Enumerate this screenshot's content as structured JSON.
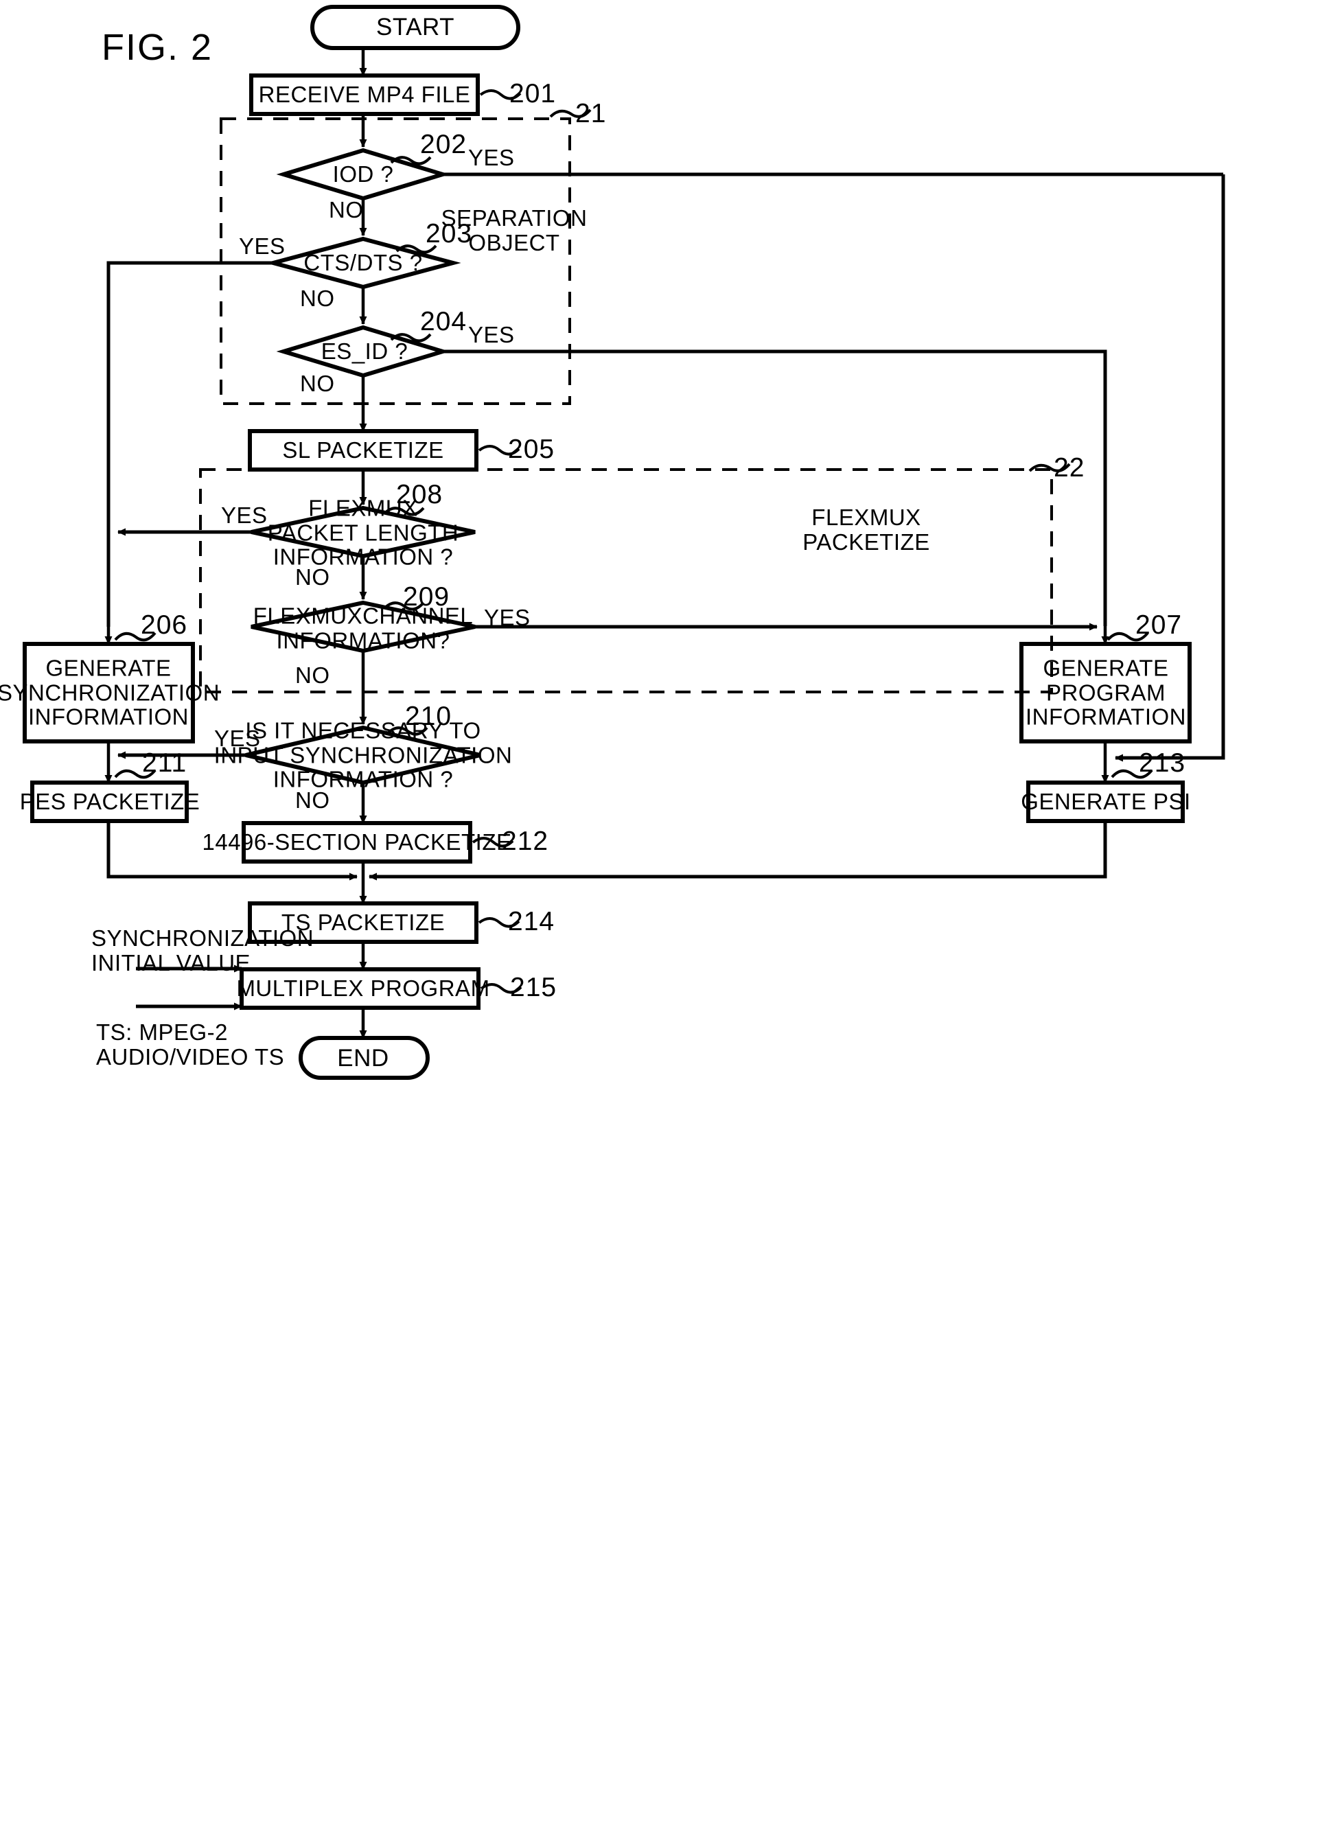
{
  "figure": {
    "title": "FIG. 2"
  },
  "nodes": {
    "start": {
      "label": "START",
      "type": "terminator"
    },
    "s201": {
      "label": "RECEIVE MP4 FILE",
      "ref": "201",
      "type": "process"
    },
    "d202": {
      "label": "IOD ?",
      "ref": "202",
      "type": "decision",
      "yes": "YES",
      "no": "NO"
    },
    "d203": {
      "label": "CTS/DTS ?",
      "ref": "203",
      "type": "decision",
      "yes": "YES",
      "no": "NO"
    },
    "d204": {
      "label": "ES_ID ?",
      "ref": "204",
      "type": "decision",
      "yes": "YES",
      "no": "NO"
    },
    "s205": {
      "label": "SL PACKETIZE",
      "ref": "205",
      "type": "process"
    },
    "s206": {
      "label": "GENERATE\nSYNCHRONIZATION\nINFORMATION",
      "ref": "206",
      "type": "process"
    },
    "s207": {
      "label": "GENERATE\nPROGRAM\nINFORMATION",
      "ref": "207",
      "type": "process"
    },
    "d208": {
      "label": "FLEXMUX\nPACKET LENGTH\nINFORMATION ?",
      "ref": "208",
      "type": "decision",
      "yes": "YES",
      "no": "NO"
    },
    "d209": {
      "label": "FLEXMUXCHANNEL\nINFORMATION?",
      "ref": "209",
      "type": "decision",
      "yes": "YES",
      "no": "NO"
    },
    "d210": {
      "label": "IS IT NECESSARY TO\nINPUT SYNCHRONIZATION\nINFORMATION ?",
      "ref": "210",
      "type": "decision",
      "yes": "YES",
      "no": "NO"
    },
    "s211": {
      "label": "PES PACKETIZE",
      "ref": "211",
      "type": "process"
    },
    "s212": {
      "label": "14496-SECTION PACKETIZE",
      "ref": "212",
      "type": "process"
    },
    "s213": {
      "label": "GENERATE PSI",
      "ref": "213",
      "type": "process"
    },
    "s214": {
      "label": "TS PACKETIZE",
      "ref": "214",
      "type": "process"
    },
    "s215": {
      "label": "MULTIPLEX PROGRAM",
      "ref": "215",
      "type": "process"
    },
    "end": {
      "label": "END",
      "type": "terminator"
    }
  },
  "groups": {
    "g21": {
      "ref": "21",
      "label": "SEPARATION\nOBJECT"
    },
    "g22": {
      "ref": "22",
      "label": "FLEXMUX\nPACKETIZE"
    }
  },
  "input_labels": {
    "sync_initial": "SYNCHRONIZATION\nINITIAL VALUE",
    "ts_mpeg2": "TS: MPEG-2\nAUDIO/VIDEO TS"
  },
  "branch_labels": {
    "d202_yes": "YES",
    "d202_no": "NO",
    "d203_yes": "YES",
    "d203_no": "NO",
    "d204_yes": "YES",
    "d204_no": "NO",
    "d208_yes": "YES",
    "d208_no": "NO",
    "d209_yes": "YES",
    "d209_no": "NO",
    "d210_yes": "YES",
    "d210_no": "NO"
  },
  "colors": {
    "stroke": "#000000",
    "background": "#ffffff"
  }
}
